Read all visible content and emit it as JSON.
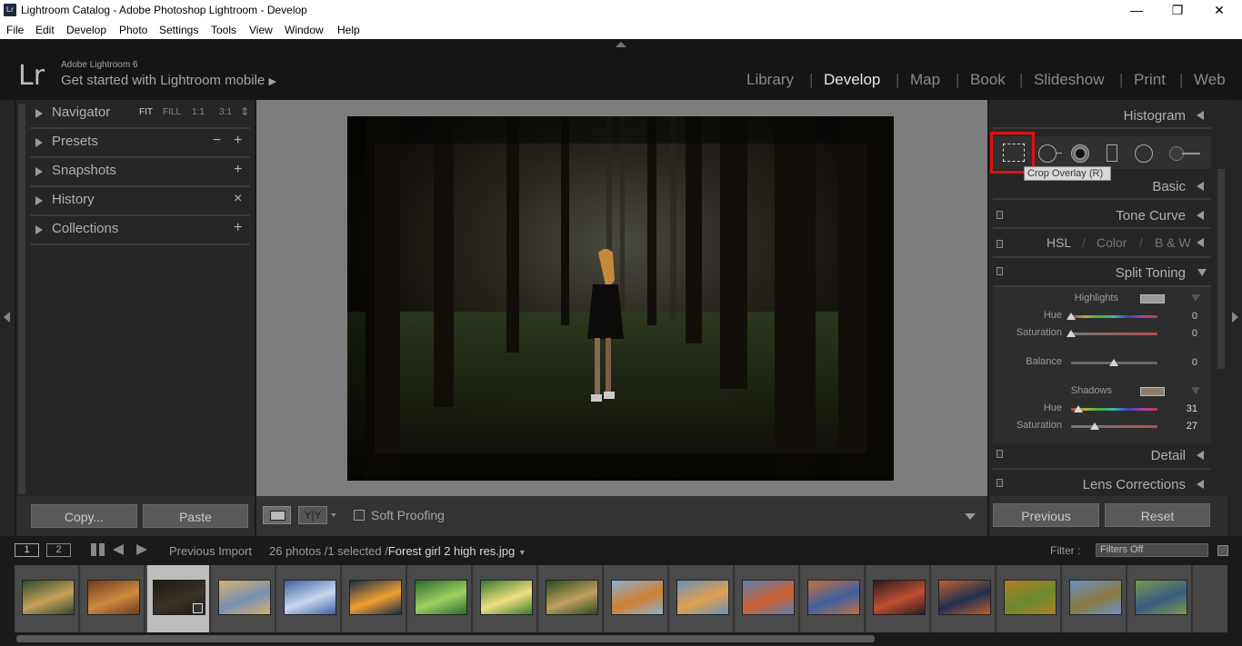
{
  "window": {
    "title": "Lightroom Catalog - Adobe Photoshop Lightroom - Develop",
    "app_icon": "Lr",
    "minimize": "—",
    "maximize": "❐",
    "close": "✕"
  },
  "menu": [
    "File",
    "Edit",
    "Develop",
    "Photo",
    "Settings",
    "Tools",
    "View",
    "Window",
    "Help"
  ],
  "identity": {
    "logo": "Lr",
    "version": "Adobe Lightroom 6",
    "mobile": "Get started with Lightroom mobile",
    "mobile_arrow": "▶"
  },
  "modules": [
    "Library",
    "Develop",
    "Map",
    "Book",
    "Slideshow",
    "Print",
    "Web"
  ],
  "active_module": "Develop",
  "left_panels": {
    "navigator": {
      "title": "Navigator",
      "zoom_options": [
        "FIT",
        "FILL",
        "1:1",
        "3:1"
      ],
      "zoom_arrow": "⇕"
    },
    "presets": {
      "title": "Presets",
      "minus": "−",
      "plus": "+"
    },
    "snapshots": {
      "title": "Snapshots",
      "plus": "+"
    },
    "history": {
      "title": "History",
      "clear": "×"
    },
    "collections": {
      "title": "Collections",
      "plus": "+"
    }
  },
  "left_buttons": {
    "copy": "Copy...",
    "paste": "Paste"
  },
  "toolbar": {
    "yy": "Y|Y",
    "soft_proofing": "Soft Proofing"
  },
  "right_panels": {
    "histogram": "Histogram",
    "tooltip": "Crop Overlay (R)",
    "basic": "Basic",
    "tone_curve": "Tone Curve",
    "hsl": {
      "hsl": "HSL",
      "color": "Color",
      "bw": "B & W",
      "sep": "/"
    },
    "split_toning": {
      "title": "Split Toning",
      "highlights": {
        "label": "Highlights",
        "swatch": "#9a9a9a",
        "hue_label": "Hue",
        "hue": "0",
        "sat_label": "Saturation",
        "sat": "0",
        "hue_value": 0,
        "sat_value": 0
      },
      "balance": {
        "label": "Balance",
        "value": "0",
        "pos": 0.5
      },
      "shadows": {
        "label": "Shadows",
        "swatch": "#8c7d70",
        "hue_label": "Hue",
        "hue": "31",
        "sat_label": "Saturation",
        "sat": "27",
        "hue_value": 31,
        "sat_value": 27
      }
    },
    "detail": "Detail",
    "lens_corrections": "Lens Corrections"
  },
  "right_buttons": {
    "previous": "Previous",
    "reset": "Reset"
  },
  "filmbar": {
    "screen1": "1",
    "screen2": "2",
    "source": "Previous Import",
    "count": "26 photos /1 selected /",
    "filename": "Forest girl 2 high res.jpg",
    "filter_label": "Filter :",
    "filter_value": "Filters Off"
  },
  "thumbs": [
    {
      "c1": "#2c4a2e",
      "c2": "#c8a05a"
    },
    {
      "c1": "#6a3a20",
      "c2": "#d08a40"
    },
    {
      "c1": "#1e1a14",
      "c2": "#3a3226",
      "selected": true
    },
    {
      "c1": "#d8b070",
      "c2": "#7890b0"
    },
    {
      "c1": "#4060a0",
      "c2": "#c8d8f0"
    },
    {
      "c1": "#1a2a4a",
      "c2": "#f0a030"
    },
    {
      "c1": "#2a6a30",
      "c2": "#a0d060"
    },
    {
      "c1": "#3a7a30",
      "c2": "#f0e080"
    },
    {
      "c1": "#2a4a20",
      "c2": "#c0a060"
    },
    {
      "c1": "#8ab0d0",
      "c2": "#d08030"
    },
    {
      "c1": "#6a90b8",
      "c2": "#e0a050"
    },
    {
      "c1": "#5a80b0",
      "c2": "#d06030"
    },
    {
      "c1": "#c07040",
      "c2": "#4060a0"
    },
    {
      "c1": "#2a1a20",
      "c2": "#c05030"
    },
    {
      "c1": "#c06030",
      "c2": "#203050"
    },
    {
      "c1": "#b08020",
      "c2": "#6a8a30"
    },
    {
      "c1": "#6a90c8",
      "c2": "#8a7a40"
    },
    {
      "c1": "#7a9a50",
      "c2": "#3a5a80"
    },
    {
      "c1": "#3a3020",
      "c2": "#a07040"
    }
  ]
}
